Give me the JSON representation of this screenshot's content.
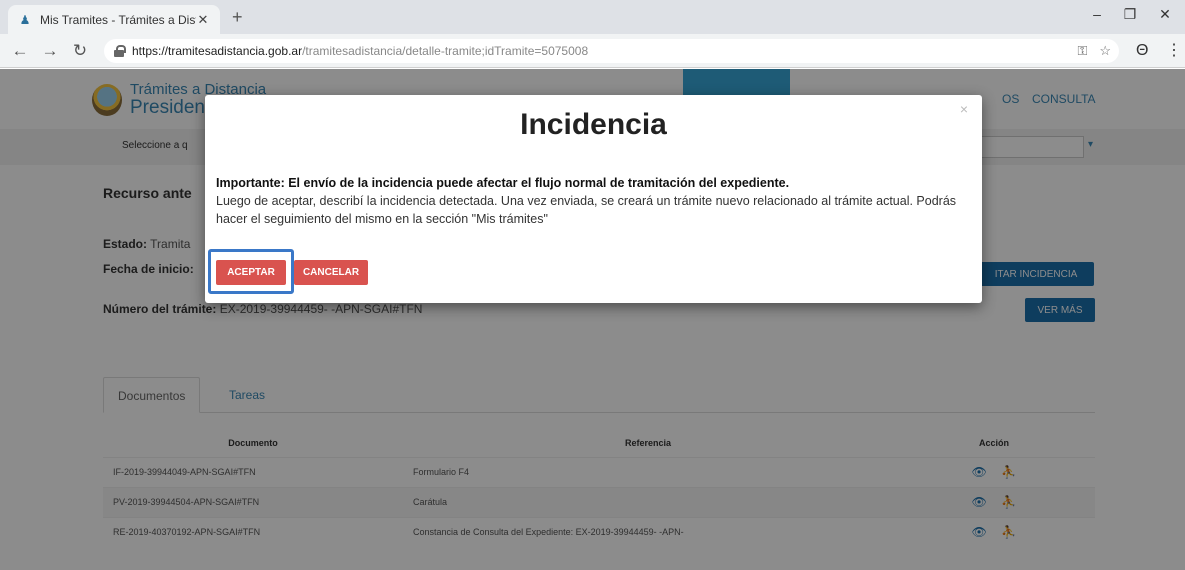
{
  "browser": {
    "tab_title": "Mis Tramites - Trámites a Distan",
    "tab_close": "✕",
    "new_tab": "+",
    "url_scheme_host": "https://tramitesadistancia.gob.ar",
    "url_path": "/tramitesadistancia/detalle-tramite;idTramite=5075008",
    "window_controls": {
      "minimize": "–",
      "maximize": "❐",
      "close": "✕"
    },
    "nav": {
      "back": "←",
      "forward": "→",
      "reload": "↻"
    },
    "icons": {
      "key": "⚿",
      "star": "☆",
      "account": "Θ",
      "menu": "⋮"
    }
  },
  "site": {
    "logo_line1": "Trámites a Distancia",
    "logo_line2": "Presidencia",
    "nav_items": [
      "",
      "",
      "",
      "",
      "OS",
      "CONSULTA"
    ],
    "subbar_label": "Seleccione a q",
    "select_arrow": "▾"
  },
  "tramite": {
    "title": "Recurso ante",
    "estado_label": "Estado:",
    "estado_value": "Tramita",
    "fecha_label": "Fecha de inicio:",
    "numero_label": "Número del trámite:",
    "numero_value": "EX-2019-39944459- -APN-SGAI#TFN",
    "btn_incidencia": "ITAR INCIDENCIA",
    "btn_ver_mas": "VER MÁS"
  },
  "tabs": {
    "documentos": "Documentos",
    "tareas": "Tareas"
  },
  "documents_table": {
    "headers": {
      "documento": "Documento",
      "referencia": "Referencia",
      "accion": "Acción"
    },
    "rows": [
      {
        "documento": "IF-2019-39944049-APN-SGAI#TFN",
        "referencia": "Formulario F4"
      },
      {
        "documento": "PV-2019-39944504-APN-SGAI#TFN",
        "referencia": "Carátula"
      },
      {
        "documento": "RE-2019-40370192-APN-SGAI#TFN",
        "referencia": "Constancia de Consulta del Expediente: EX-2019-39944459- -APN-"
      }
    ],
    "action_icons": {
      "view": "👁",
      "assign": "⛹"
    }
  },
  "modal": {
    "title": "Incidencia",
    "close": "×",
    "warning": "Importante: El envío de la incidencia puede afectar el flujo normal de tramitación del expediente.",
    "message": "Luego de aceptar, describí la incidencia detectada. Una vez enviada, se creará un trámite nuevo relacionado al trámite actual. Podrás hacer el seguimiento del mismo en la sección \"Mis trámites\"",
    "accept_label": "ACEPTAR",
    "cancel_label": "CANCELAR"
  },
  "colors": {
    "accept": "#d9534f",
    "focus_ring": "#3a78c8",
    "primary_blue": "#1a6fab",
    "nav_active": "#37a6d8"
  }
}
